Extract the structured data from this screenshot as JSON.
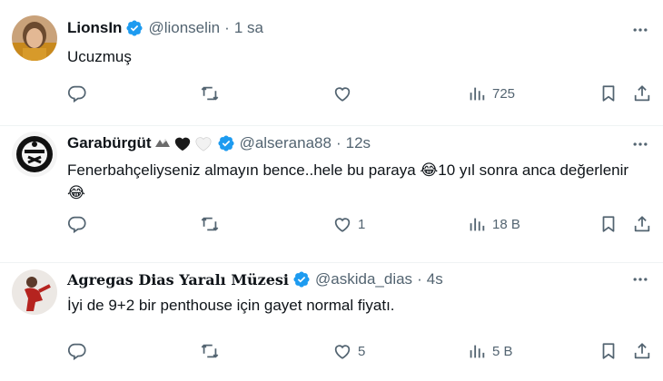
{
  "tweets": [
    {
      "name": "LionsIn",
      "handle": "@lionselin",
      "dot": "·",
      "time": "1 sa",
      "text": "Ucuzmuş",
      "reply_count": "",
      "retweet_count": "",
      "like_count": "",
      "view_count": "725"
    },
    {
      "name": "Garabürgüt",
      "handle": "@alserana88",
      "dot": "·",
      "time": "12s",
      "text": "Fenerbahçeliyseniz almayın bence..hele bu paraya 😂10 yıl sonra anca değerlenir😂",
      "reply_count": "",
      "retweet_count": "",
      "like_count": "1",
      "view_count": "18 B"
    },
    {
      "name": "Agregas Dias Yaralı Müzesi",
      "handle": "@askida_dias",
      "dot": "·",
      "time": "4s",
      "text": "İyi de 9+2 bir penthouse için gayet normal fiyatı.",
      "reply_count": "",
      "retweet_count": "",
      "like_count": "5",
      "view_count": "5 B"
    }
  ],
  "icons": {
    "verified": "verified-badge-icon",
    "more": "more-icon",
    "reply": "reply-icon",
    "retweet": "retweet-icon",
    "like": "like-icon",
    "views": "views-icon",
    "bookmark": "bookmark-icon",
    "share": "share-icon"
  },
  "colors": {
    "verified": "#1d9bf0",
    "secondary_text": "#536471",
    "primary_text": "#0f1419",
    "divider": "#eff3f4"
  }
}
